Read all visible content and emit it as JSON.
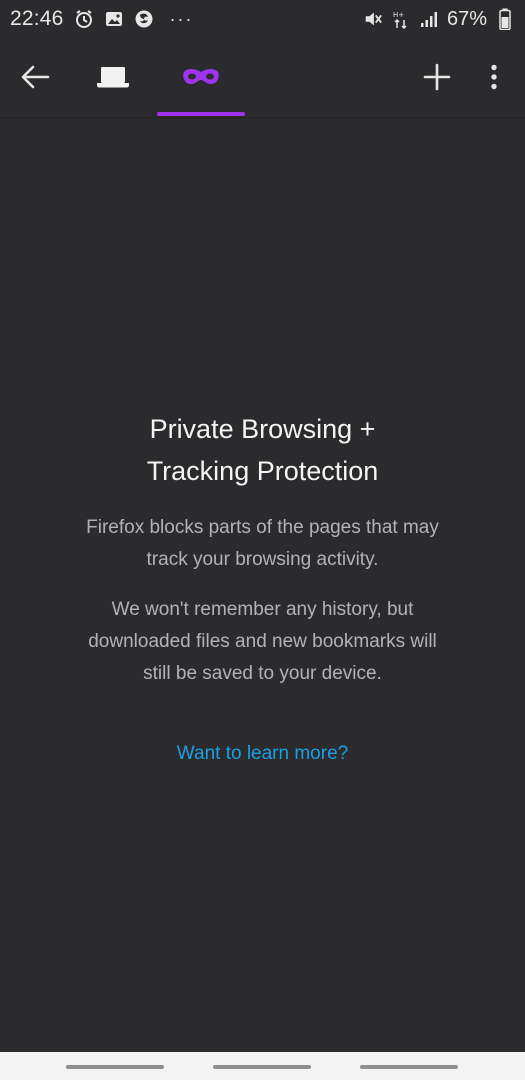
{
  "status_bar": {
    "time": "22:46",
    "battery": "67%",
    "icons": [
      "alarm-icon",
      "gallery-icon",
      "firefox-icon",
      "more-dots-icon",
      "mute-icon",
      "data-arrows-icon",
      "signal-icon",
      "battery-icon"
    ],
    "more": "···"
  },
  "toolbar": {
    "back_icon": "arrow-left-icon",
    "normal_tabs_icon": "laptop-icon",
    "private_tabs_icon": "private-mask-icon",
    "new_tab_icon": "plus-icon",
    "menu_icon": "kebab-menu-icon",
    "accent_color": "#a033ee"
  },
  "content": {
    "title_line1": "Private Browsing +",
    "title_line2": "Tracking Protection",
    "desc1_line1": "Firefox blocks parts of the pages that may",
    "desc1_line2": "track your browsing activity.",
    "desc2_line1": "We won't remember any history, but",
    "desc2_line2": "downloaded files and new bookmarks will",
    "desc2_line3": "still be saved to your device.",
    "learn_more": "Want to learn more?",
    "link_color": "#19a0e6"
  }
}
